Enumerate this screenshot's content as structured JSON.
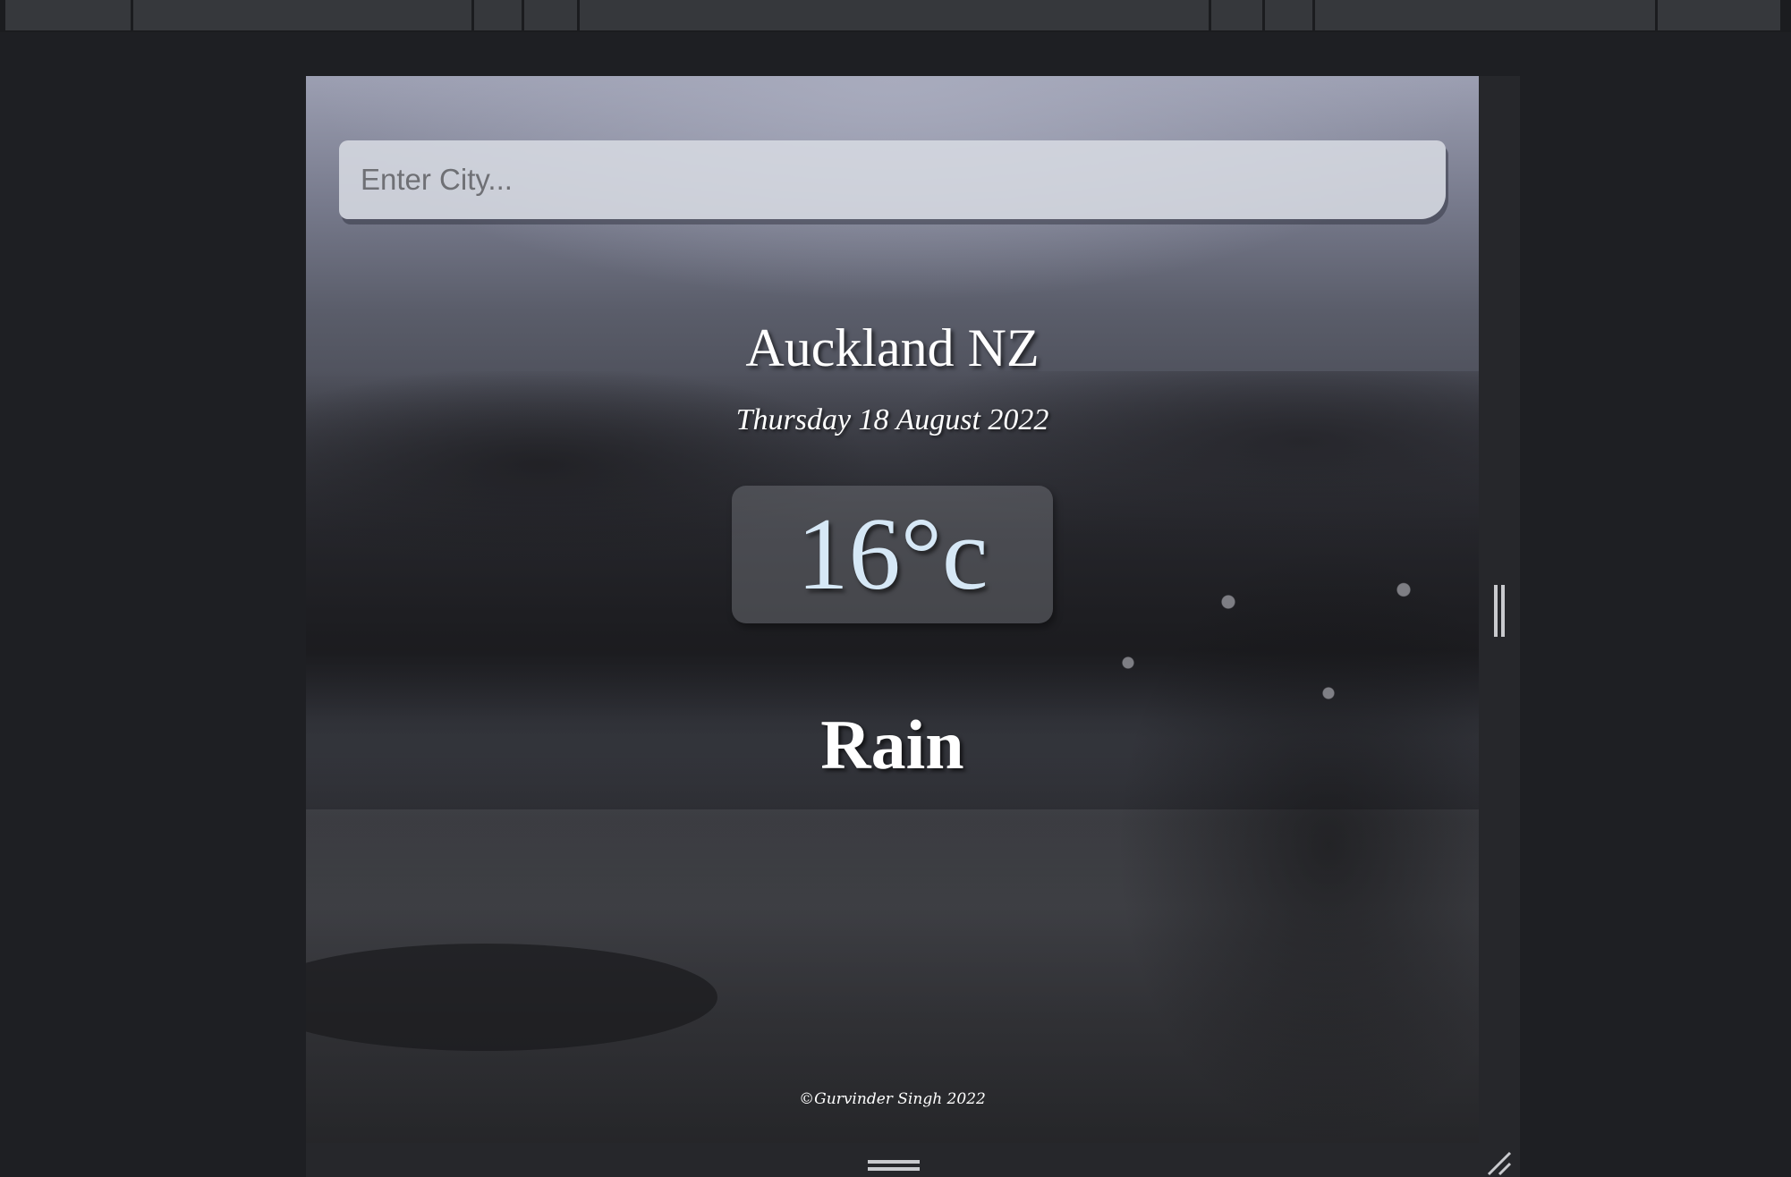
{
  "weather_app": {
    "search": {
      "placeholder": "Enter City...",
      "value": ""
    },
    "location": "Auckland NZ",
    "date": "Thursday 18 August 2022",
    "temperature": "16°c",
    "condition": "Rain",
    "footer": "©Gurvinder Singh 2022"
  },
  "icons": {
    "vertical_resize": "vertical-resize-handle-icon",
    "horizontal_resize": "horizontal-resize-handle-icon",
    "corner_resize": "corner-resize-icon"
  },
  "colors": {
    "temperature_text": "#d6e8f6",
    "editor_background": "#1e1f23"
  }
}
